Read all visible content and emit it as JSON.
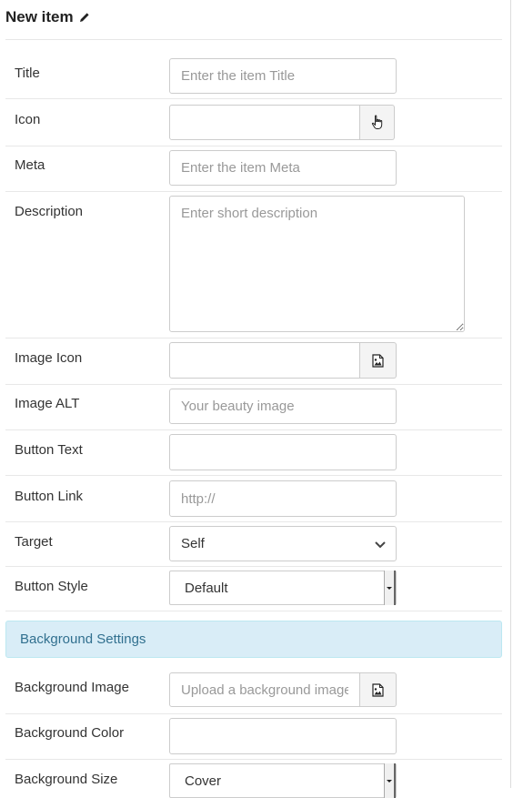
{
  "header": {
    "title": "New item",
    "edit_icon": "pencil-icon"
  },
  "fields": {
    "title": {
      "label": "Title",
      "placeholder": "Enter the item Title",
      "value": ""
    },
    "icon": {
      "label": "Icon",
      "value": "",
      "button_icon": "hand-pointer-icon"
    },
    "meta": {
      "label": "Meta",
      "placeholder": "Enter the item Meta",
      "value": ""
    },
    "description": {
      "label": "Description",
      "placeholder": "Enter short description",
      "value": ""
    },
    "image_icon": {
      "label": "Image Icon",
      "value": "",
      "button_icon": "image-file-icon"
    },
    "image_alt": {
      "label": "Image ALT",
      "placeholder": "Your beauty image",
      "value": ""
    },
    "button_text": {
      "label": "Button Text",
      "value": ""
    },
    "button_link": {
      "label": "Button Link",
      "placeholder": "http://",
      "value": ""
    },
    "target": {
      "label": "Target",
      "selected": "Self"
    },
    "button_style": {
      "label": "Button Style",
      "selected": "Default"
    }
  },
  "background_section": {
    "title": "Background Settings"
  },
  "background_fields": {
    "image": {
      "label": "Background Image",
      "placeholder": "Upload a background image",
      "value": "",
      "button_icon": "image-file-icon"
    },
    "color": {
      "label": "Background Color",
      "value": ""
    },
    "size": {
      "label": "Background Size",
      "selected": "Cover"
    }
  },
  "colors": {
    "section_bg": "#d9edf7",
    "section_text": "#31708f",
    "border": "#cccccc"
  }
}
